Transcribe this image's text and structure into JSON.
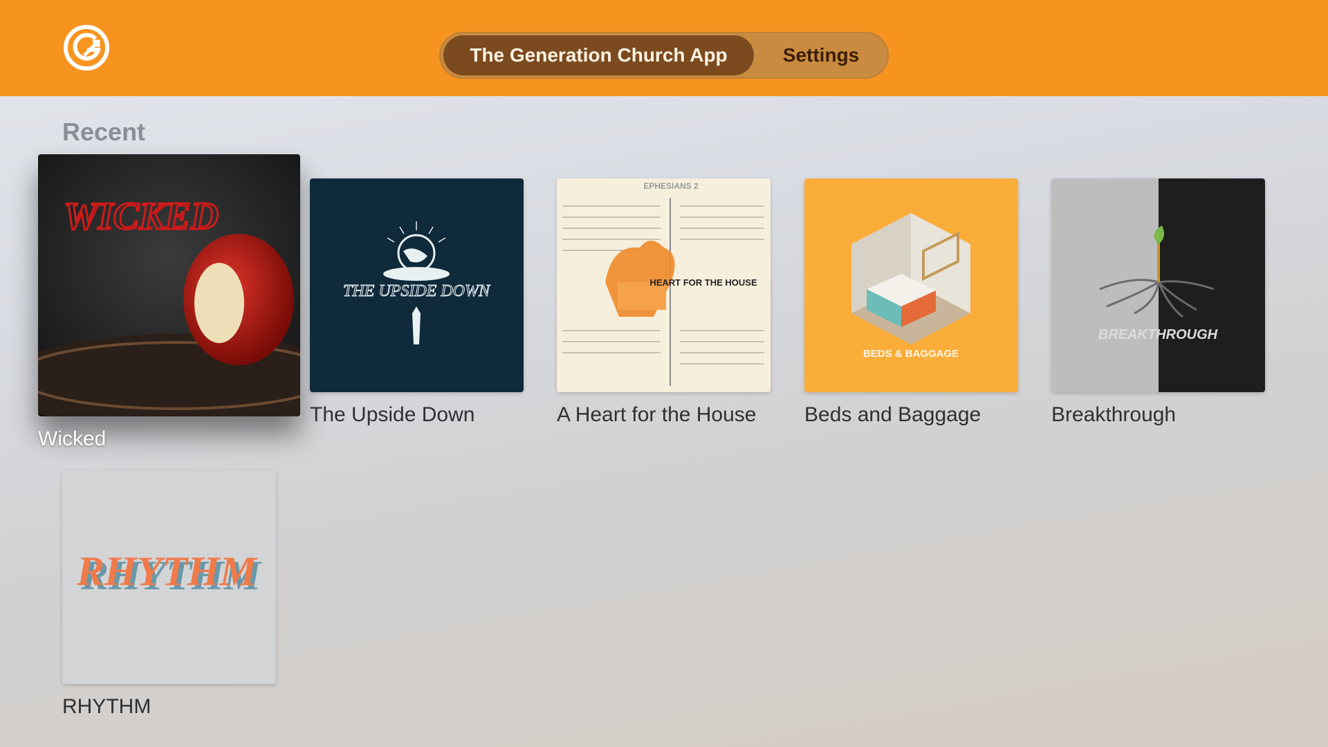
{
  "header": {
    "tabs": [
      {
        "label": "The Generation Church App",
        "active": true
      },
      {
        "label": "Settings",
        "active": false
      }
    ],
    "accent_color": "#f7941f"
  },
  "section": {
    "title": "Recent"
  },
  "items": [
    {
      "title": "Wicked",
      "artwork_text": "WICKED",
      "icon": "bitten-apple-artwork",
      "focused": true
    },
    {
      "title": "The Upside Down",
      "artwork_text": "THE UPSIDE DOWN",
      "icon": "globe-hand-artwork"
    },
    {
      "title": "A Heart for the House",
      "artwork_text": "HEART FOR THE HOUSE",
      "artwork_heading": "EPHESIANS 2",
      "icon": "heart-house-artwork"
    },
    {
      "title": "Beds and Baggage",
      "artwork_text": "BEDS & BAGGAGE",
      "icon": "bedroom-artwork"
    },
    {
      "title": "Breakthrough",
      "artwork_text": "BREAKTHROUGH",
      "icon": "roots-artwork"
    },
    {
      "title": "RHYTHM",
      "artwork_text": "RHYTHM",
      "icon": "rhythm-artwork"
    }
  ]
}
